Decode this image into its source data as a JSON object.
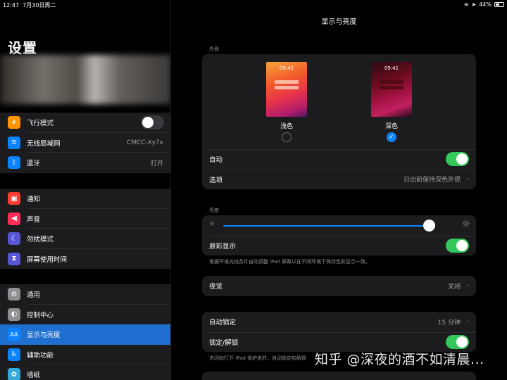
{
  "status_bar": {
    "time": "12:47",
    "date": "7月30日周二",
    "battery": "44%",
    "battery_level": 0.44
  },
  "sidebar": {
    "title": "设置",
    "group1": [
      {
        "label": "飞行模式",
        "icon": "airplane-icon",
        "color": "#ff9500",
        "glyph": "✈",
        "toggle": "off"
      },
      {
        "label": "无线局域网",
        "icon": "wifi-icon",
        "color": "#0a84ff",
        "glyph": "≋",
        "value": "CMCC-Xy7x"
      },
      {
        "label": "蓝牙",
        "icon": "bluetooth-icon",
        "color": "#0a84ff",
        "glyph": "ᛒ",
        "value": "打开"
      }
    ],
    "group2": [
      {
        "label": "通知",
        "icon": "notifications-icon",
        "color": "#ff3b30",
        "glyph": "▣"
      },
      {
        "label": "声音",
        "icon": "sound-icon",
        "color": "#ff2d55",
        "glyph": "◀"
      },
      {
        "label": "勿扰模式",
        "icon": "moon-icon",
        "color": "#5856d6",
        "glyph": "☾"
      },
      {
        "label": "屏幕使用时间",
        "icon": "hourglass-icon",
        "color": "#5856d6",
        "glyph": "⧗"
      }
    ],
    "group3": [
      {
        "label": "通用",
        "icon": "gear-icon",
        "color": "#8e8e93",
        "glyph": "⚙"
      },
      {
        "label": "控制中心",
        "icon": "control-center-icon",
        "color": "#8e8e93",
        "glyph": "◐"
      },
      {
        "label": "显示与亮度",
        "icon": "display-icon",
        "color": "#0a84ff",
        "glyph": "AA",
        "active": true
      },
      {
        "label": "辅助功能",
        "icon": "accessibility-icon",
        "color": "#0a84ff",
        "glyph": "♿"
      },
      {
        "label": "墙纸",
        "icon": "wallpaper-icon",
        "color": "#34aadc",
        "glyph": "✿"
      }
    ]
  },
  "main": {
    "title": "显示与亮度",
    "appearance": {
      "header": "外观",
      "preview_time": "09:41",
      "light_label": "浅色",
      "dark_label": "深色",
      "selected": "dark",
      "auto_label": "自动",
      "auto_on": true,
      "options_label": "选项",
      "options_value": "日出前保持深色外观"
    },
    "brightness": {
      "header": "亮度",
      "level": 0.95,
      "true_tone_label": "原彩显示",
      "true_tone_on": true,
      "note": "根据环境光线条件自动调整 iPad 屏幕以在不同环境下保持色彩显示一致。"
    },
    "night_shift": {
      "label": "夜览",
      "value": "关闭"
    },
    "lock": {
      "auto_lock_label": "自动锁定",
      "auto_lock_value": "15 分钟",
      "lock_unlock_label": "锁定/解锁",
      "lock_unlock_on": true,
      "note": "关闭和打开 iPad 保护盖时，自动锁定和解锁"
    }
  },
  "watermark": "知乎 @深夜的酒不如清晨..."
}
